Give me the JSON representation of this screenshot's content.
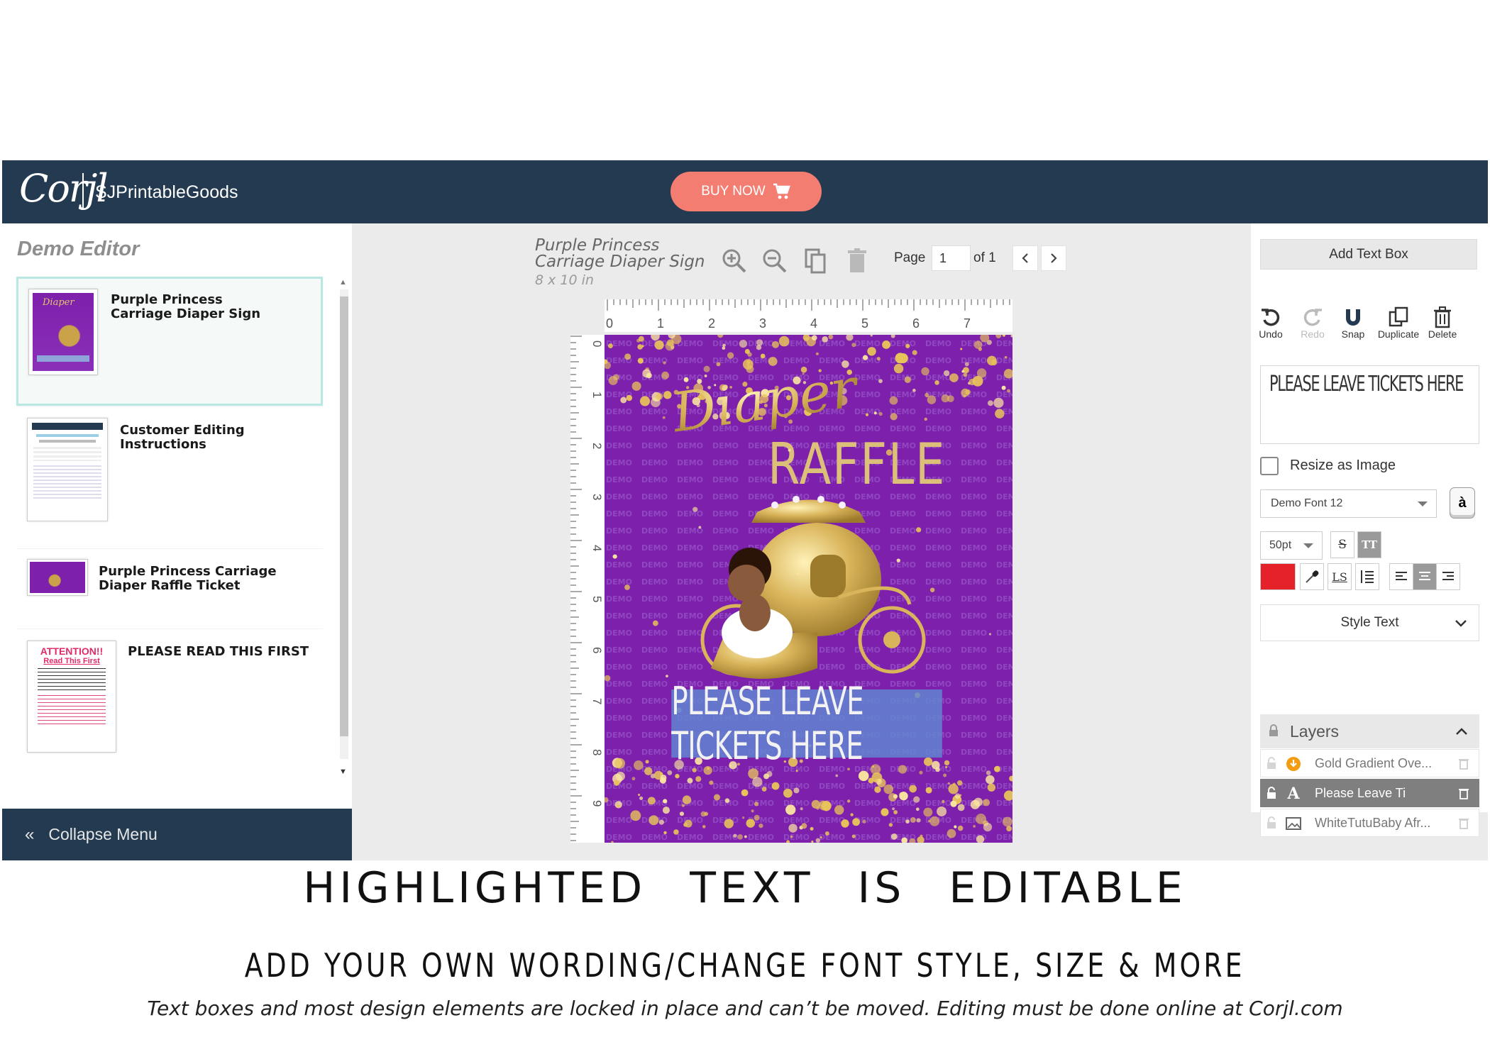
{
  "header": {
    "logo_text": "Corjl",
    "shop_name": "SJPrintableGoods",
    "buy_label": "BUY NOW"
  },
  "sidebar": {
    "title": "Demo Editor",
    "items": [
      {
        "label": "Purple Princess Carriage Diaper Sign"
      },
      {
        "label": "Customer Editing Instructions"
      },
      {
        "label": "Purple Princess Carriage Diaper Raffle Ticket"
      },
      {
        "label": "PLEASE READ THIS FIRST"
      }
    ],
    "thumb_attention": "ATTENTION!!",
    "thumb_read": "Read This First",
    "collapse_label": "Collapse Menu"
  },
  "document": {
    "title": "Purple Princess Carriage Diaper Sign",
    "size": "8 x 10 in",
    "page_label": "Page",
    "page_value": "1",
    "page_of": "of 1",
    "ruler_h": [
      "0",
      "1",
      "2",
      "3",
      "4",
      "5",
      "6",
      "7"
    ],
    "ruler_v": [
      "0",
      "1",
      "2",
      "3",
      "4",
      "5",
      "6",
      "7",
      "8",
      "9"
    ],
    "design_diaper": "Diaper",
    "design_raffle": "RAFFLE",
    "watermark": "DEMO",
    "editable_text": "PLEASE LEAVE TICKETS HERE"
  },
  "right": {
    "add_text_box": "Add Text Box",
    "tools": [
      {
        "label": "Undo",
        "icon": "undo-icon"
      },
      {
        "label": "Redo",
        "icon": "redo-icon"
      },
      {
        "label": "Snap",
        "icon": "magnet-icon"
      },
      {
        "label": "Duplicate",
        "icon": "duplicate-icon"
      },
      {
        "label": "Delete",
        "icon": "trash-icon"
      }
    ],
    "text_value": "PLEASE LEAVE TICKETS HERE",
    "resize_label": "Resize as Image",
    "font": "Demo Font 12",
    "font_btn": "à",
    "size": "50pt",
    "strike_label": "S",
    "tt_label": "TT",
    "ls_label": "LS",
    "text_color": "#e5222a",
    "style_text": "Style Text",
    "layers_title": "Layers",
    "layers": [
      {
        "name": "Gold Gradient Ove...",
        "icon": "download-circle-icon"
      },
      {
        "name": "Please Leave Ti",
        "icon": "text-a-icon"
      },
      {
        "name": "WhiteTutuBaby Afr...",
        "icon": "image-icon"
      }
    ]
  },
  "captions": {
    "line1": "HIGHLIGHTED TEXT IS EDITABLE",
    "line2": "ADD YOUR OWN WORDING/CHANGE FONT STYLE, SIZE & MORE",
    "line3": "Text boxes and most design elements are locked in place and can’t be moved. Editing must be done online at Corjl.com"
  }
}
